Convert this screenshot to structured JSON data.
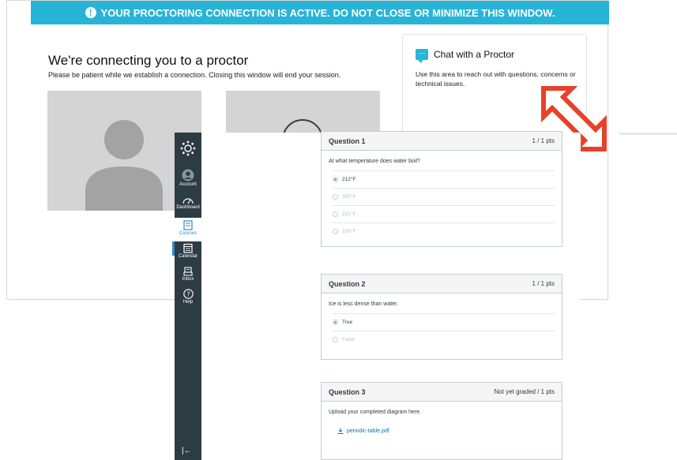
{
  "proctor": {
    "banner_text": "YOUR PROCTORING CONNECTION IS ACTIVE. DO NOT CLOSE OR MINIMIZE THIS WINDOW.",
    "banner_icon": "info-icon",
    "connect_title": "We're connecting you to a proctor",
    "connect_subtitle": "Please be patient while we establish a connection. Closing this window will end your session.",
    "chat": {
      "title": "Chat with a Proctor",
      "body": "Use this area to reach out with questions, concerns or technical issues.",
      "icon": "chat-bubble-icon"
    },
    "colors": {
      "banner": "#28b4d6",
      "arrow": "#e8402a"
    }
  },
  "nav": {
    "items": [
      {
        "label": "Account",
        "icon": "account-icon"
      },
      {
        "label": "Dashboard",
        "icon": "dashboard-icon"
      },
      {
        "label": "Courses",
        "icon": "courses-icon",
        "active": true
      },
      {
        "label": "Calendar",
        "icon": "calendar-icon"
      },
      {
        "label": "Inbox",
        "icon": "inbox-icon"
      },
      {
        "label": "Help",
        "icon": "help-icon"
      }
    ],
    "collapse_icon": "|←",
    "colors": {
      "background": "#2d3b45",
      "active_text": "#2d8bcc"
    }
  },
  "questions": [
    {
      "title": "Question 1",
      "points": "1 / 1 pts",
      "text": "At what temperature does water boil?",
      "answers": [
        {
          "label": "212°F",
          "selected": true
        },
        {
          "label": "300°F",
          "selected": false
        },
        {
          "label": "221°F",
          "selected": false
        },
        {
          "label": "100°F",
          "selected": false
        }
      ]
    },
    {
      "title": "Question 2",
      "points": "1 / 1 pts",
      "text": "Ice is less dense than water.",
      "answers": [
        {
          "label": "True",
          "selected": true
        },
        {
          "label": "False",
          "selected": false
        }
      ]
    },
    {
      "title": "Question 3",
      "points": "Not yet graded / 1 pts",
      "text": "Upload your completed diagram here.",
      "file": "periodic-table.pdf"
    }
  ]
}
